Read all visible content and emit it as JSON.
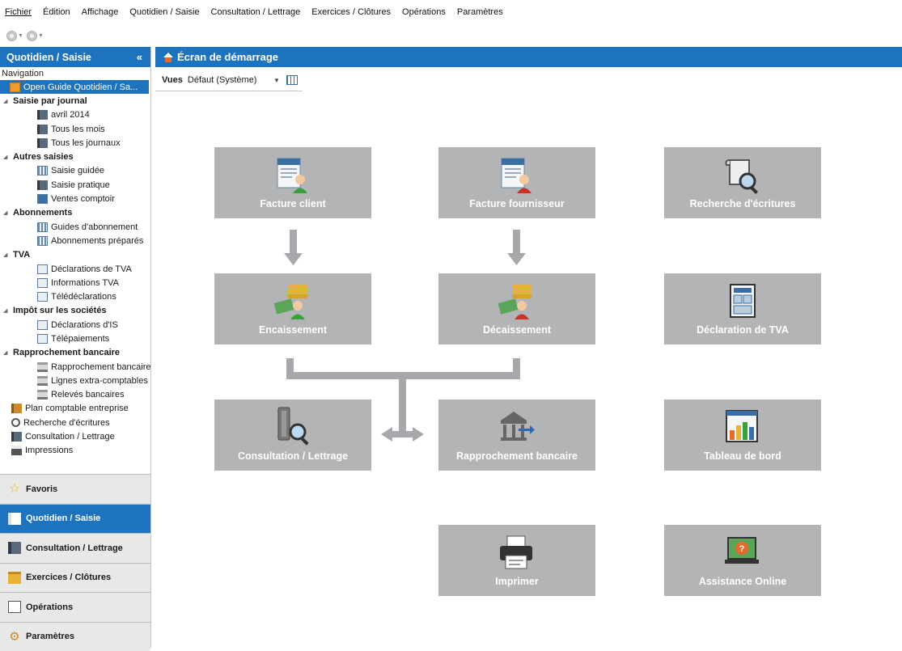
{
  "menu": [
    "Fichier",
    "Édition",
    "Affichage",
    "Quotidien / Saisie",
    "Consultation / Lettrage",
    "Exercices / Clôtures",
    "Opérations",
    "Paramètres"
  ],
  "sidebar": {
    "title": "Quotidien / Saisie",
    "collapse_label": "«",
    "navigation_label": "Navigation",
    "open_guide": "Open Guide Quotidien / Sa...",
    "groups": [
      {
        "label": "Saisie par journal",
        "items": [
          "avril 2014",
          "Tous les mois",
          "Tous les journaux"
        ]
      },
      {
        "label": "Autres saisies",
        "items": [
          "Saisie guidée",
          "Saisie pratique",
          "Ventes comptoir"
        ]
      },
      {
        "label": "Abonnements",
        "items": [
          "Guides d'abonnement",
          "Abonnements préparés"
        ]
      },
      {
        "label": "TVA",
        "items": [
          "Déclarations de TVA",
          "Informations TVA",
          "Télédéclarations"
        ]
      },
      {
        "label": "Impôt sur les sociétés",
        "items": [
          "Déclarations d'IS",
          "Télépaiements"
        ]
      },
      {
        "label": "Rapprochement bancaire",
        "items": [
          "Rapprochement bancaire",
          "Lignes extra-comptables",
          "Relevés bancaires"
        ]
      }
    ],
    "extra_items": [
      "Plan comptable entreprise",
      "Recherche d'écritures",
      "Consultation / Lettrage",
      "Impressions"
    ],
    "buttons": [
      "Favoris",
      "Quotidien / Saisie",
      "Consultation / Lettrage",
      "Exercices / Clôtures",
      "Opérations",
      "Paramètres"
    ]
  },
  "main": {
    "title": "Écran de démarrage",
    "views_label": "Vues",
    "views_value": "Défaut (Système)"
  },
  "tiles": {
    "facture_client": "Facture client",
    "facture_fournisseur": "Facture fournisseur",
    "recherche_ecritures": "Recherche d'écritures",
    "encaissement": "Encaissement",
    "decaissement": "Décaissement",
    "declaration_tva": "Déclaration de TVA",
    "consultation_lettrage": "Consultation / Lettrage",
    "rapprochement_bancaire": "Rapprochement bancaire",
    "tableau_de_bord": "Tableau de bord",
    "imprimer": "Imprimer",
    "assistance_online": "Assistance Online"
  },
  "colors": {
    "accent": "#1e73be",
    "tile": "#b3b4b6",
    "connector": "#a6a8ab"
  }
}
